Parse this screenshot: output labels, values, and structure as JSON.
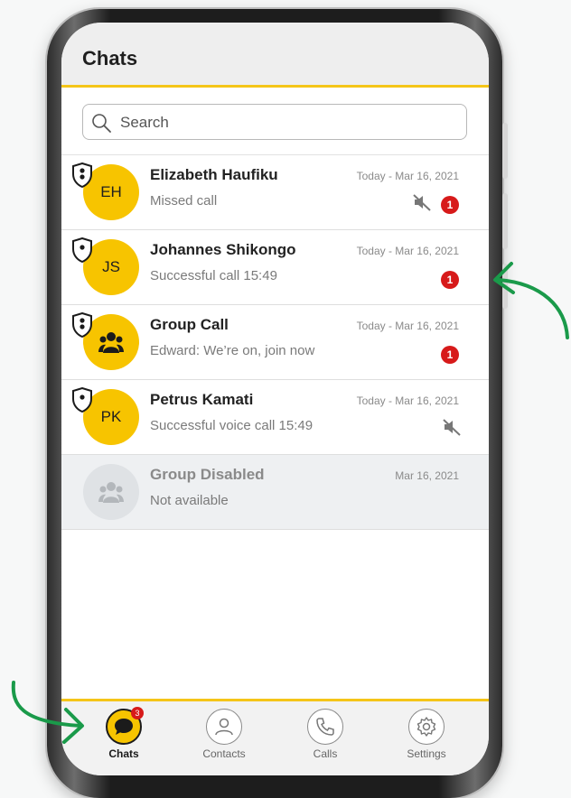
{
  "app": {
    "title": "Chats"
  },
  "search": {
    "placeholder": "Search"
  },
  "chats": [
    {
      "initials": "EH",
      "name": "Elizabeth Haufiku",
      "preview": "Missed call",
      "time": "Today - Mar 16, 2021",
      "muted": true,
      "unread": "1",
      "shield": "locked",
      "disabled": false
    },
    {
      "initials": "JS",
      "name": "Johannes Shikongo",
      "preview": "Successful call 15:49",
      "time": "Today - Mar 16, 2021",
      "muted": false,
      "unread": "1",
      "shield": "single",
      "disabled": false
    },
    {
      "initials": "",
      "name": "Group Call",
      "preview": "Edward: We’re on, join now",
      "time": "Today - Mar 16, 2021",
      "muted": false,
      "unread": "1",
      "shield": "locked",
      "disabled": false,
      "group": true
    },
    {
      "initials": "PK",
      "name": "Petrus Kamati",
      "preview": "Successful voice call 15:49",
      "time": "Today - Mar 16, 2021",
      "muted": true,
      "unread": "",
      "shield": "single",
      "disabled": false
    },
    {
      "initials": "",
      "name": "Group Disabled",
      "preview": "Not available",
      "time": "Mar 16, 2021",
      "muted": false,
      "unread": "",
      "shield": "",
      "disabled": true,
      "group": true
    }
  ],
  "nav": {
    "items": [
      {
        "label": "Chats",
        "icon": "chat-bubble-icon",
        "active": true,
        "badge": "3"
      },
      {
        "label": "Contacts",
        "icon": "person-icon",
        "active": false,
        "badge": ""
      },
      {
        "label": "Calls",
        "icon": "phone-icon",
        "active": false,
        "badge": ""
      },
      {
        "label": "Settings",
        "icon": "gear-icon",
        "active": false,
        "badge": ""
      }
    ]
  },
  "colors": {
    "accent": "#f5c518",
    "avatar": "#f7c400",
    "badge": "#d71a1a",
    "annotation": "#1a9a4a"
  }
}
